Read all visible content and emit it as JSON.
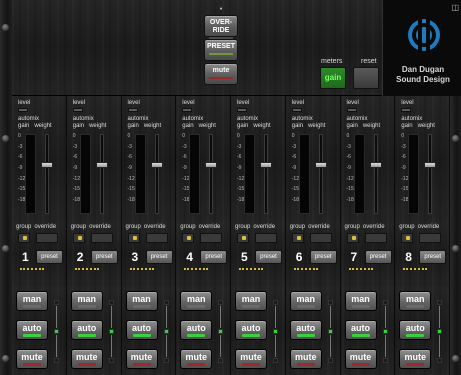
{
  "header": {
    "override_indicator": "•",
    "override_label": "OVER- RIDE",
    "preset_label": "PRESET",
    "mute_label": "mute",
    "meters_label": "meters",
    "reset_label": "reset",
    "gain_label": "gain"
  },
  "logo": {
    "line1": "Dan Dugan",
    "line2": "Sound Design",
    "icon": "dugan-logo-icon",
    "corner_icon": "expand-icon"
  },
  "channel_labels": {
    "level": "level",
    "automix": "automix",
    "gain": "gain",
    "weight": "weight",
    "group": "group",
    "override": "override",
    "preset": "preset",
    "man": "man",
    "auto": "auto",
    "mute": "mute",
    "scale": [
      "0",
      "-3",
      "-6",
      "-9",
      "-12",
      "-15",
      "-18"
    ]
  },
  "channels": [
    {
      "number": "1",
      "weight": 0.62
    },
    {
      "number": "2",
      "weight": 0.62
    },
    {
      "number": "3",
      "weight": 0.62
    },
    {
      "number": "4",
      "weight": 0.62
    },
    {
      "number": "5",
      "weight": 0.62
    },
    {
      "number": "6",
      "weight": 0.62
    },
    {
      "number": "7",
      "weight": 0.62
    },
    {
      "number": "8",
      "weight": 0.62
    }
  ],
  "colors": {
    "active_green": "#3ad040",
    "mute_red": "#a02828",
    "group_yellow": "#d8c23a"
  }
}
